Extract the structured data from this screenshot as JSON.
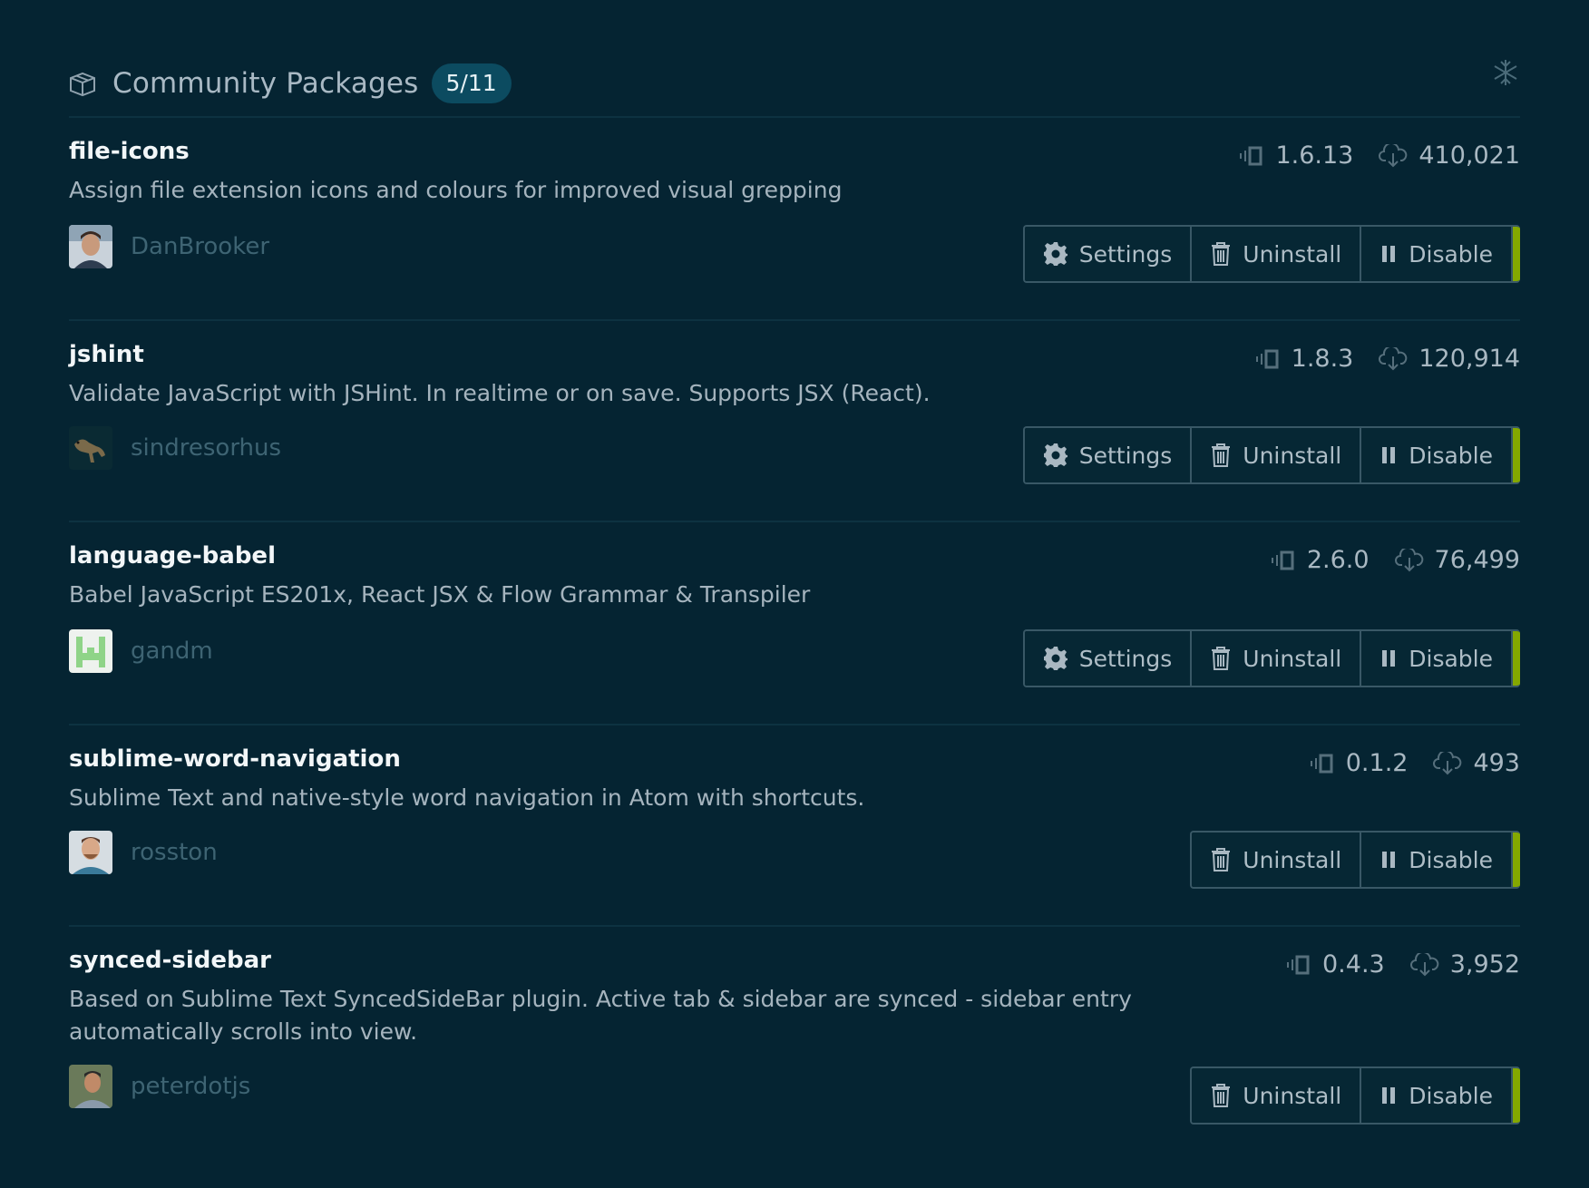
{
  "header": {
    "title": "Community Packages",
    "badge": "5/11"
  },
  "packages": [
    {
      "name": "file-icons",
      "description": "Assign file extension icons and colours for improved visual grepping",
      "version": "1.6.13",
      "downloads": "410,021",
      "owner": "DanBrooker",
      "buttons": {
        "settings": "Settings",
        "uninstall": "Uninstall",
        "disable": "Disable"
      }
    },
    {
      "name": "jshint",
      "description": "Validate JavaScript with JSHint. In realtime or on save. Supports JSX (React).",
      "version": "1.8.3",
      "downloads": "120,914",
      "owner": "sindresorhus",
      "buttons": {
        "settings": "Settings",
        "uninstall": "Uninstall",
        "disable": "Disable"
      }
    },
    {
      "name": "language-babel",
      "description": "Babel JavaScript ES201x, React JSX & Flow Grammar & Transpiler",
      "version": "2.6.0",
      "downloads": "76,499",
      "owner": "gandm",
      "buttons": {
        "settings": "Settings",
        "uninstall": "Uninstall",
        "disable": "Disable"
      }
    },
    {
      "name": "sublime-word-navigation",
      "description": "Sublime Text and native-style word navigation in Atom with shortcuts.",
      "version": "0.1.2",
      "downloads": "493",
      "owner": "rosston",
      "buttons": {
        "uninstall": "Uninstall",
        "disable": "Disable"
      }
    },
    {
      "name": "synced-sidebar",
      "description": "Based on Sublime Text SyncedSideBar plugin. Active tab & sidebar are synced - sidebar entry automatically scrolls into view.",
      "version": "0.4.3",
      "downloads": "3,952",
      "owner": "peterdotjs",
      "buttons": {
        "uninstall": "Uninstall",
        "disable": "Disable"
      }
    }
  ],
  "colors": {
    "background": "#052432",
    "accent_enabled": "#84a800",
    "badge_bg": "#0c4b60"
  },
  "icons": {
    "header": "package-icon",
    "collapse": "collapse-icon",
    "version": "versions-icon",
    "downloads": "cloud-download-icon",
    "settings": "gear-icon",
    "uninstall": "trashcan-icon",
    "disable": "pause-icon"
  }
}
